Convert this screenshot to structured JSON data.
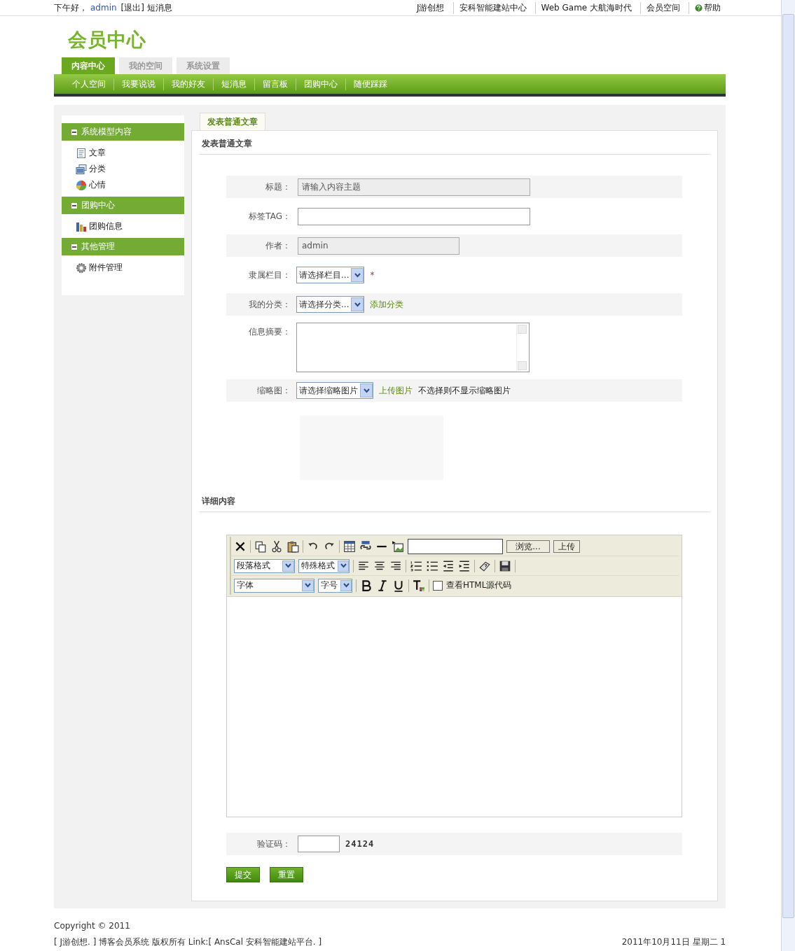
{
  "top_bar": {
    "greeting": "下午好，",
    "user": "admin",
    "logout": "[退出]",
    "messages": "短消息",
    "links": [
      {
        "label": "J游创想",
        "kind": "text"
      },
      {
        "label": "安科智能建站中心",
        "kind": "text"
      },
      {
        "label": "Web Game 大航海时代",
        "kind": "text"
      },
      {
        "label": "会员空间",
        "kind": "text"
      },
      {
        "label": "帮助",
        "kind": "help"
      }
    ]
  },
  "logo": "会员中心",
  "tabs": [
    {
      "label": "内容中心",
      "selected": true
    },
    {
      "label": "我的空间",
      "selected": false
    },
    {
      "label": "系统设置",
      "selected": false
    }
  ],
  "nav": [
    "个人空间",
    "我要说说",
    "我的好友",
    "短消息",
    "留言板",
    "团购中心",
    "随便踩踩"
  ],
  "sidebar": {
    "groups": [
      {
        "title": "系统模型内容",
        "expanded": true,
        "items": [
          "文章",
          "分类",
          "心情"
        ]
      },
      {
        "title": "团购中心",
        "expanded": true,
        "items": [
          "团购信息"
        ]
      },
      {
        "title": "其他管理",
        "expanded": true,
        "items": [
          "附件管理"
        ]
      }
    ]
  },
  "content_tab": {
    "label": "发表普通文章",
    "selected": true
  },
  "form": {
    "title": "发表普通文章",
    "rows": [
      {
        "kind": "text",
        "label": "标题：",
        "value": "请输入内容主题",
        "disabled": true
      },
      {
        "kind": "text",
        "label": "标签TAG：",
        "disabled": false
      },
      {
        "kind": "short_text",
        "label": "作者：",
        "value": "admin",
        "disabled": true
      },
      {
        "kind": "select",
        "label": "隶属栏目：",
        "value": "请选择栏目...",
        "required": "*"
      },
      {
        "kind": "select",
        "label": "我的分类：",
        "value": "请选择分类...",
        "link": "添加分类"
      },
      {
        "kind": "textarea",
        "label": "信息摘要："
      },
      {
        "kind": "select",
        "label": "缩略图：",
        "value": "请选择缩略图片",
        "link": "上传图片",
        "note": "不选择则不显示缩略图片"
      }
    ]
  },
  "detail_title": "详细内容",
  "editor": {
    "browse_button": "浏览...",
    "upload_button": "上传",
    "paragraph_select": "段落格式",
    "special_select": "特殊格式",
    "font_select": "字体",
    "size_select": "字号",
    "source_toggle": {
      "label": "查看HTML源代码",
      "checked": false
    }
  },
  "captcha": {
    "label": "验证码：",
    "code": "24124"
  },
  "buttons": [
    "提交",
    "重置"
  ],
  "footer": {
    "copyright": "Copyright © 2011",
    "credits": "[ J游创想. ] 博客会员系统 版权所有 Link:[ AnsCal 安科智能建站平台. ]",
    "date": "2011年10月11日 星期二 1"
  }
}
